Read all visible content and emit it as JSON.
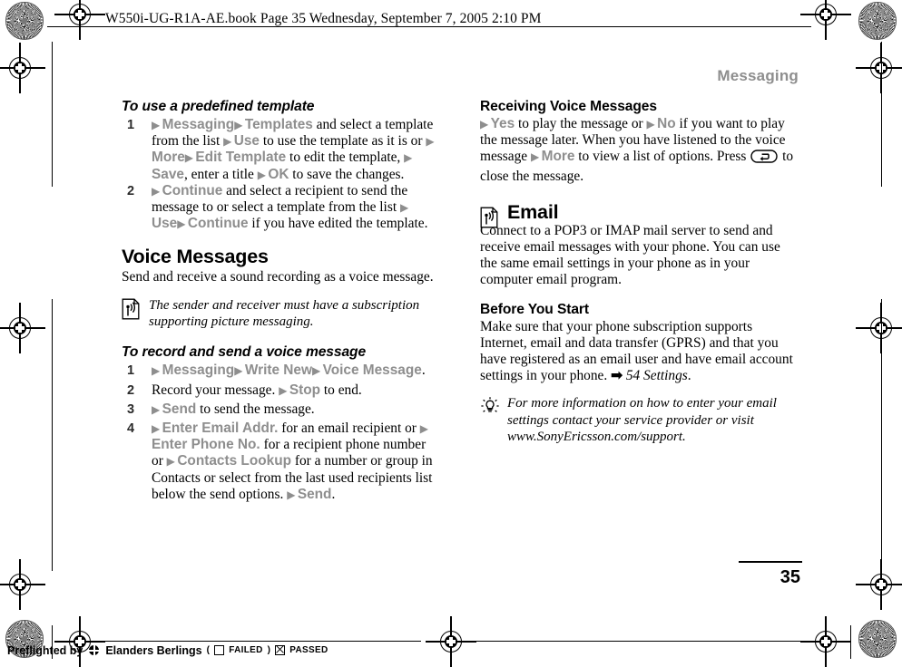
{
  "colors": {
    "command_gray": "#8e8e8e",
    "header_gray": "#8e8e8e",
    "text": "#000000"
  },
  "slug": {
    "text": "W550i-UG-R1A-AE.book  Page 35  Wednesday, September 7, 2005  2:10 PM"
  },
  "running_head": {
    "title": "Messaging"
  },
  "folio": {
    "page_number": "35"
  },
  "left_column": {
    "procedure_template": {
      "heading": "To use a predefined template",
      "steps": [
        {
          "number": "1",
          "parts": [
            {
              "t": "arrow"
            },
            {
              "t": "cmd",
              "v": "Messaging"
            },
            {
              "t": "arrow"
            },
            {
              "t": "cmd",
              "v": "Templates"
            },
            {
              "t": "text",
              "v": " and select a template from the list "
            },
            {
              "t": "arrow"
            },
            {
              "t": "cmd",
              "v": "Use"
            },
            {
              "t": "text",
              "v": " to use the template as it is or "
            },
            {
              "t": "arrow"
            },
            {
              "t": "cmd",
              "v": "More"
            },
            {
              "t": "arrow"
            },
            {
              "t": "cmd",
              "v": "Edit Template"
            },
            {
              "t": "text",
              "v": " to edit the template, "
            },
            {
              "t": "arrow"
            },
            {
              "t": "cmd",
              "v": "Save"
            },
            {
              "t": "text",
              "v": ", enter a title "
            },
            {
              "t": "arrow"
            },
            {
              "t": "cmd",
              "v": "OK"
            },
            {
              "t": "text",
              "v": " to save the changes."
            }
          ]
        },
        {
          "number": "2",
          "parts": [
            {
              "t": "arrow"
            },
            {
              "t": "cmd",
              "v": "Continue"
            },
            {
              "t": "text",
              "v": " and select a recipient to send the message to or select a template from the list "
            },
            {
              "t": "arrow"
            },
            {
              "t": "cmd",
              "v": "Use"
            },
            {
              "t": "arrow"
            },
            {
              "t": "cmd",
              "v": "Continue"
            },
            {
              "t": "text",
              "v": " if you have edited the template."
            }
          ]
        }
      ]
    },
    "voice_messages": {
      "heading": "Voice Messages",
      "body": "Send and receive a sound recording as a voice message.",
      "note": {
        "icon": "mms-signal-icon",
        "text": "The sender and receiver must have a subscription supporting picture messaging."
      }
    },
    "procedure_record": {
      "heading": "To record and send a voice message",
      "steps": [
        {
          "number": "1",
          "parts": [
            {
              "t": "arrow"
            },
            {
              "t": "cmd",
              "v": "Messaging"
            },
            {
              "t": "arrow"
            },
            {
              "t": "cmd",
              "v": "Write New"
            },
            {
              "t": "arrow"
            },
            {
              "t": "cmd",
              "v": "Voice Message"
            },
            {
              "t": "text",
              "v": "."
            }
          ]
        },
        {
          "number": "2",
          "parts": [
            {
              "t": "text",
              "v": "Record your message. "
            },
            {
              "t": "arrow"
            },
            {
              "t": "cmd",
              "v": "Stop"
            },
            {
              "t": "text",
              "v": " to end."
            }
          ]
        },
        {
          "number": "3",
          "parts": [
            {
              "t": "arrow"
            },
            {
              "t": "cmd",
              "v": "Send"
            },
            {
              "t": "text",
              "v": " to send the message."
            }
          ]
        },
        {
          "number": "4",
          "parts": [
            {
              "t": "arrow"
            },
            {
              "t": "cmd",
              "v": "Enter Email Addr."
            },
            {
              "t": "text",
              "v": " for an email recipient or "
            },
            {
              "t": "arrow"
            },
            {
              "t": "cmd",
              "v": "Enter Phone No."
            },
            {
              "t": "text",
              "v": " for a recipient phone number or "
            },
            {
              "t": "arrow"
            },
            {
              "t": "cmd",
              "v": "Contacts Lookup"
            },
            {
              "t": "text",
              "v": " for a number or group in Contacts or select from the last used recipients list below the send options. "
            },
            {
              "t": "arrow"
            },
            {
              "t": "cmd",
              "v": "Send"
            },
            {
              "t": "text",
              "v": "."
            }
          ]
        }
      ]
    }
  },
  "right_column": {
    "receiving": {
      "heading": "Receiving Voice Messages",
      "parts": [
        {
          "t": "arrow"
        },
        {
          "t": "cmd",
          "v": "Yes"
        },
        {
          "t": "text",
          "v": " to play the message or "
        },
        {
          "t": "arrow"
        },
        {
          "t": "cmd",
          "v": "No"
        },
        {
          "t": "text",
          "v": " if you want to play the message later. When you have listened to the voice message "
        },
        {
          "t": "arrow"
        },
        {
          "t": "cmd",
          "v": "More"
        },
        {
          "t": "text",
          "v": " to view a list of options. Press "
        },
        {
          "t": "key",
          "v": "back-key-icon"
        },
        {
          "t": "text",
          "v": " to close the message."
        }
      ]
    },
    "email": {
      "icon": "mms-signal-icon",
      "heading": "Email",
      "body": "Connect to a POP3 or IMAP mail server to send and receive email messages with your phone. You can use the same email settings in your phone as in your computer email program."
    },
    "before_you_start": {
      "heading": "Before You Start",
      "parts": [
        {
          "t": "text",
          "v": "Make sure that your phone subscription supports Internet, email and data transfer (GPRS) and that you have registered as an email user and have email account settings in your phone. "
        },
        {
          "t": "xrefarrow"
        },
        {
          "t": "xref",
          "v": "54 Settings"
        },
        {
          "t": "text",
          "v": "."
        }
      ]
    },
    "tip": {
      "icon": "lightbulb-tip-icon",
      "text": "For more information on how to enter your email settings contact your service provider or visit www.SonyEricsson.com/support."
    }
  },
  "preflight": {
    "prefix": "Preflighted by",
    "company": "Elanders Berlings",
    "open_paren": "(",
    "failed_label": "FAILED",
    "close_paren": ")",
    "passed_label": "PASSED"
  }
}
